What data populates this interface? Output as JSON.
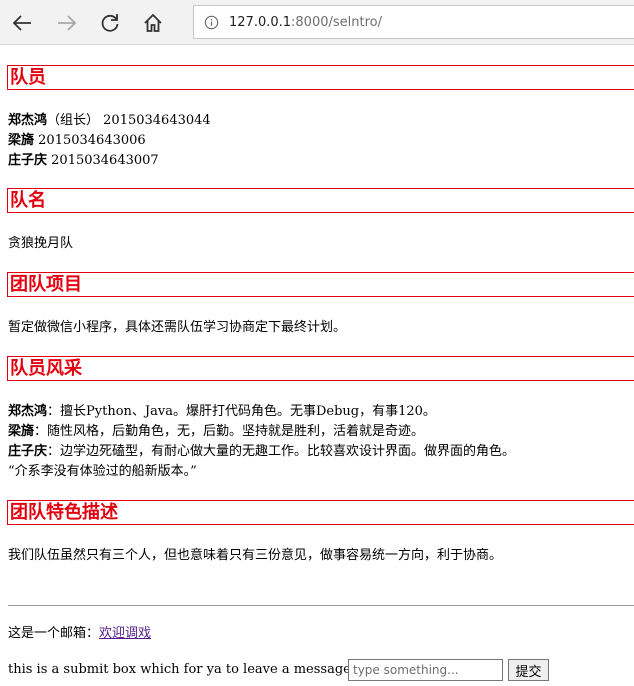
{
  "browser": {
    "url_host": "127.0.0.1",
    "url_rest": ":8000/selntro/"
  },
  "sections": {
    "members": {
      "heading": "队员",
      "rows": [
        {
          "name": "郑杰鸿",
          "detail": "（组长）  2015034643044"
        },
        {
          "name": "梁旖",
          "detail": " 2015034643006"
        },
        {
          "name": "庄子庆",
          "detail": " 2015034643007"
        }
      ]
    },
    "team_name": {
      "heading": "队名",
      "text": "贪狼挽月队"
    },
    "project": {
      "heading": "团队项目",
      "text": "暂定做微信小程序，具体还需队伍学习协商定下最终计划。"
    },
    "style": {
      "heading": "队员风采",
      "rows": [
        {
          "name": "郑杰鸿",
          "detail": "：擅长Python、Java。爆肝打代码角色。无事Debug，有事120。"
        },
        {
          "name": "梁旖",
          "detail": "：随性风格，后勤角色，无，后勤。坚持就是胜利，活着就是奇迹。"
        },
        {
          "name": "庄子庆",
          "detail": "：边学边死磕型，有耐心做大量的无趣工作。比较喜欢设计界面。做界面的角色。"
        }
      ],
      "quote": "“介系李没有体验过的船新版本。”"
    },
    "feature": {
      "heading": "团队特色描述",
      "text": "我们队伍虽然只有三个人，但也意味着只有三份意见，做事容易统一方向，利于协商。"
    }
  },
  "footer": {
    "mail_prefix": "这是一个邮箱：",
    "mail_link": "欢迎调戏",
    "message_label": "this is a submit box which for ya to leave a message: ",
    "input_placeholder": "type something...",
    "submit_label": "提交"
  }
}
